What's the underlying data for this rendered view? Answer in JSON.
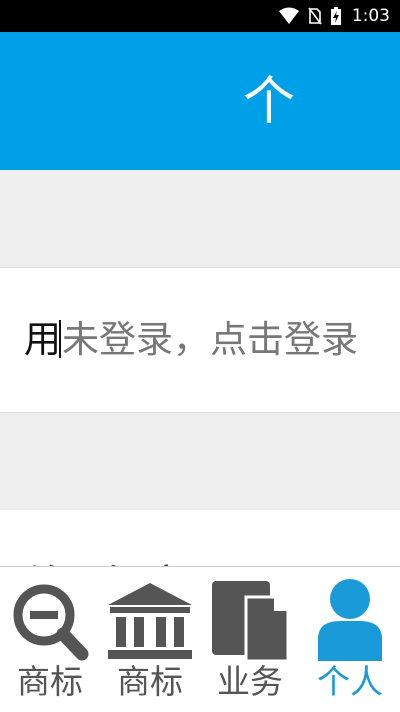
{
  "status_bar": {
    "time": "1:03",
    "icons": [
      "wifi-icon",
      "no-sim-icon",
      "battery-charging-icon"
    ]
  },
  "header": {
    "title": "个"
  },
  "login": {
    "first_char": "用",
    "prompt": "未登录，点击登录"
  },
  "partial_row": {
    "text": "修改密码"
  },
  "tabs": [
    {
      "label": "商标",
      "icon": "search-minus-icon",
      "active": false
    },
    {
      "label": "商标",
      "icon": "bank-icon",
      "active": false
    },
    {
      "label": "业务",
      "icon": "documents-icon",
      "active": false
    },
    {
      "label": "个人",
      "icon": "person-icon",
      "active": true
    }
  ],
  "colors": {
    "primary": "#00a0e9",
    "active_tab": "#1a9ad6",
    "inactive_tab": "#555555",
    "background_gray": "#efefef"
  }
}
